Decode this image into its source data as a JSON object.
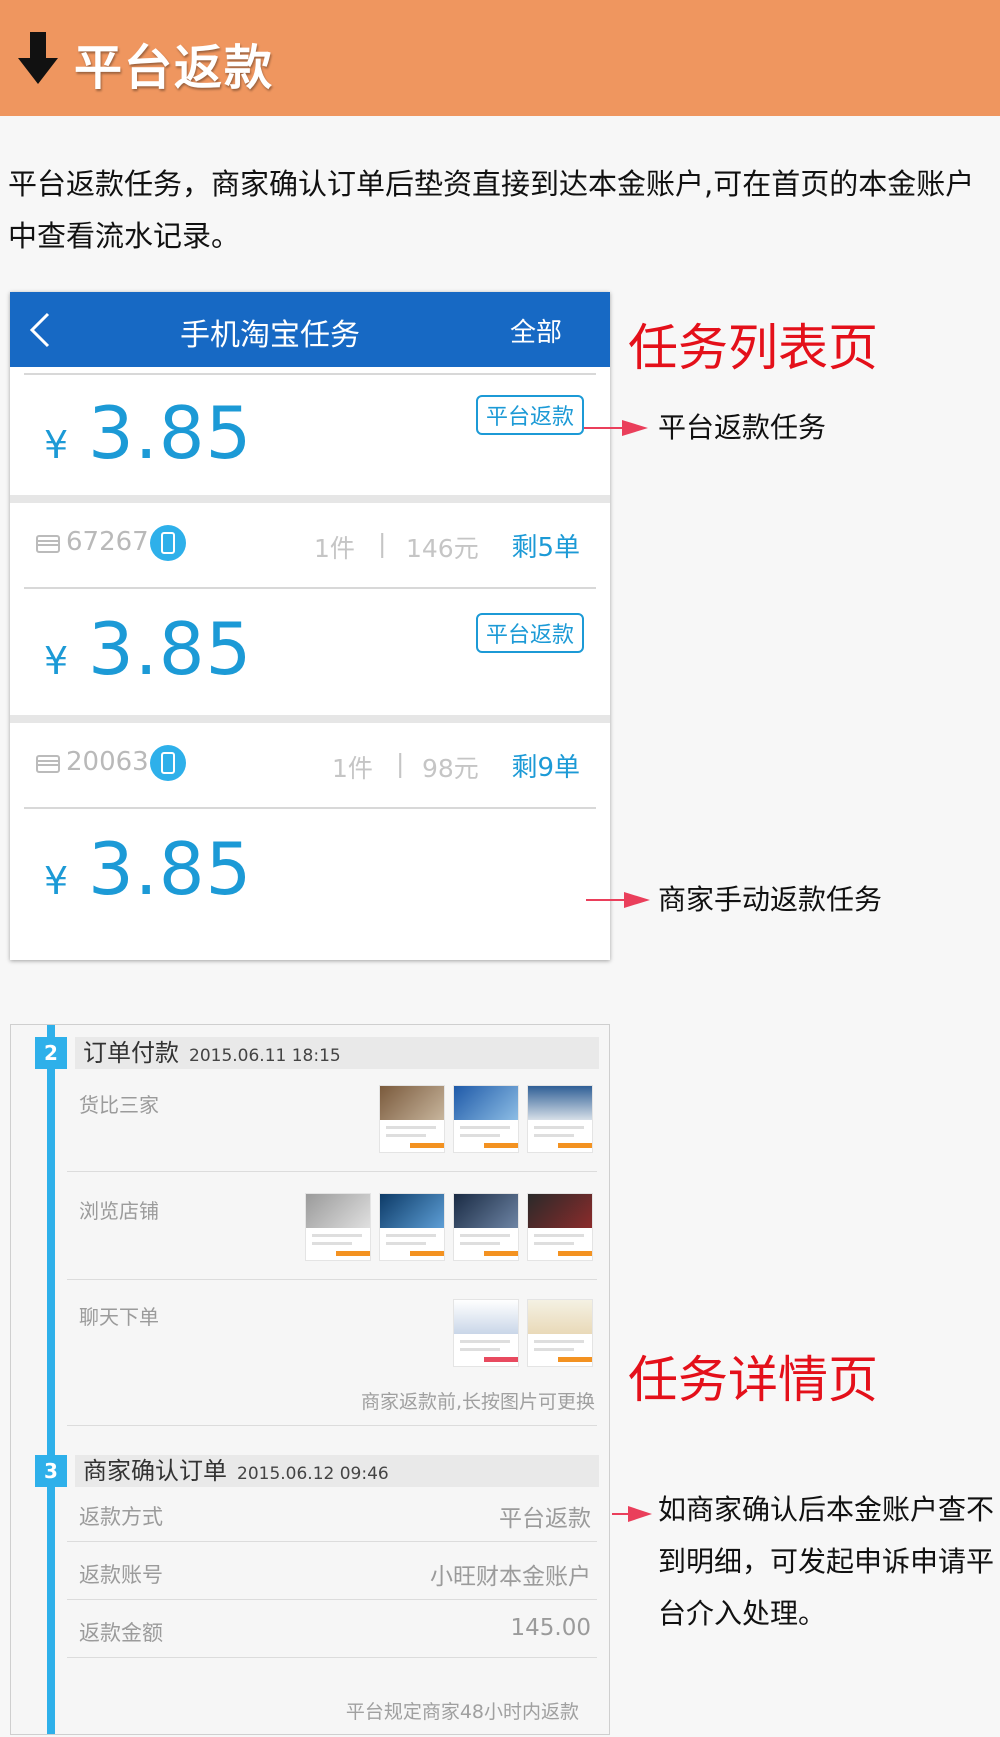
{
  "banner": {
    "title": "平台返款",
    "icon": "down-arrow-icon",
    "bg": "#ef965f"
  },
  "intro": "平台返款任务，商家确认订单后垫资直接到达本金账户,可在首页的本金账户中查看流水记录。",
  "list_page": {
    "nav": {
      "back_icon": "chevron-left-icon",
      "title": "手机淘宝任务",
      "right": "全部"
    },
    "tasks": [
      {
        "yen": "¥",
        "amount": "3.85",
        "tag": "平台返款"
      },
      {
        "shop_id": "67267",
        "qty": "1件",
        "divider": "|",
        "price": "146元",
        "remain": "剩5单",
        "yen": "¥",
        "amount": "3.85",
        "tag": "平台返款"
      },
      {
        "shop_id": "20063",
        "qty": "1件",
        "divider": "|",
        "price": "98元",
        "remain": "剩9单",
        "yen": "¥",
        "amount": "3.85",
        "tag": ""
      }
    ]
  },
  "annotations": {
    "list_title": "任务列表页",
    "platform_task": "平台返款任务",
    "merchant_task": "商家手动返款任务",
    "detail_title": "任务详情页",
    "note": "如商家确认后本金账户查不到明细，可发起申诉申请平台介入处理。"
  },
  "detail_page": {
    "step2": {
      "num": "2",
      "title": "订单付款",
      "time": "2015.06.11 18:15",
      "rows": [
        "货比三家",
        "浏览店铺",
        "聊天下单"
      ],
      "hint": "商家返款前,长按图片可更换"
    },
    "step3": {
      "num": "3",
      "title": "商家确认订单",
      "time": "2015.06.12 09:46",
      "kv": [
        {
          "k": "返款方式",
          "v": "平台返款"
        },
        {
          "k": "返款账号",
          "v": "小旺财本金账户"
        },
        {
          "k": "返款金额",
          "v": "145.00"
        }
      ],
      "footer": "平台规定商家48小时内返款"
    }
  },
  "colors": {
    "blue": "#1c9ad6",
    "nav": "#1769c4",
    "red": "#e4101a",
    "timeline": "#2eb0ea"
  }
}
